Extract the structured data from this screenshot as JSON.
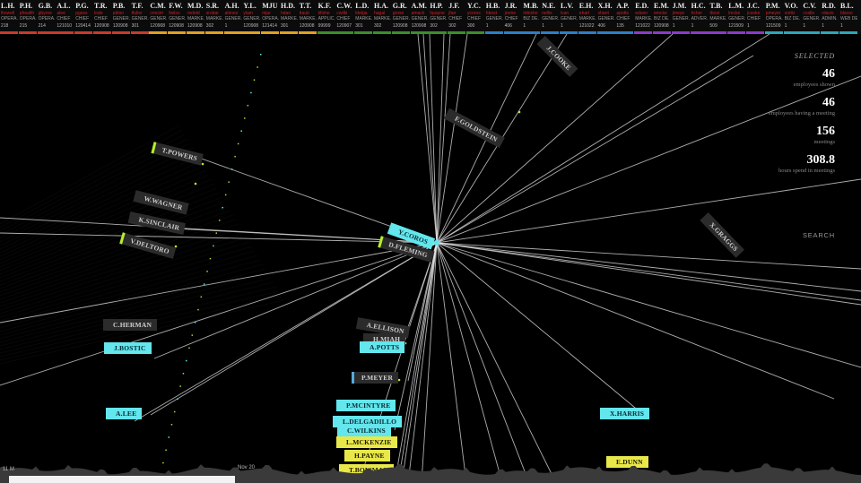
{
  "header": {
    "columns": [
      {
        "name": "L.H.",
        "email": "lhowell",
        "title": "OPERA.",
        "phone": "218",
        "color": "#c83a2a"
      },
      {
        "name": "P.H.",
        "email": "phealth",
        "title": "OPERA.",
        "phone": "215",
        "color": "#c83a2a"
      },
      {
        "name": "G.B.",
        "email": "gbyrne",
        "title": "OPERA.",
        "phone": "214",
        "color": "#c83a2a"
      },
      {
        "name": "A.L.",
        "email": "alee",
        "title": "CHIEF",
        "phone": "121010",
        "color": "#c83a2a"
      },
      {
        "name": "P.G.",
        "email": "pgoss",
        "title": "CHIEF",
        "phone": "120414",
        "color": "#c83a2a"
      },
      {
        "name": "T.R.",
        "email": "trale",
        "title": "CHIEF",
        "phone": "120908",
        "color": "#c83a2a"
      },
      {
        "name": "P.B.",
        "email": "pbloo",
        "title": "GENER.",
        "phone": "120908",
        "color": "#c83a2a"
      },
      {
        "name": "T.F.",
        "email": "tfuller",
        "title": "GENER.",
        "phone": "301",
        "color": "#c83a2a"
      },
      {
        "name": "C.M.",
        "email": "cmcint",
        "title": "GENER.",
        "phone": "120908",
        "color": "#e0a020"
      },
      {
        "name": "F.W.",
        "email": "fwilso",
        "title": "GENER.",
        "phone": "120908",
        "color": "#e0a020"
      },
      {
        "name": "M.D.",
        "email": "mdeld",
        "title": "MARKE.",
        "phone": "120908",
        "color": "#e0a020"
      },
      {
        "name": "S.R.",
        "email": "srobar",
        "title": "MARKE.",
        "phone": "302",
        "color": "#e0a020"
      },
      {
        "name": "A.H.",
        "email": "ahinez",
        "title": "GENER.",
        "phone": "1",
        "color": "#e0a020"
      },
      {
        "name": "Y.L.",
        "email": "ylam",
        "title": "GENER.",
        "phone": "120908",
        "color": "#e0a020"
      },
      {
        "name": "MJU",
        "email": "mjur",
        "title": "OPERA.",
        "phone": "121414",
        "color": "#e0a020"
      },
      {
        "name": "H.D.",
        "email": "hdan",
        "title": "MARKE.",
        "phone": "301",
        "color": "#e0a020"
      },
      {
        "name": "T.T.",
        "email": "ttaub",
        "title": "MARKE.",
        "phone": "120908",
        "color": "#e0a020"
      },
      {
        "name": "K.F.",
        "email": "kfishe",
        "title": "APPLIC.",
        "phone": "99999",
        "color": "#3a8f2a"
      },
      {
        "name": "C.W.",
        "email": "cwilki",
        "title": "CHIEF",
        "phone": "120907",
        "color": "#3a8f2a"
      },
      {
        "name": "L.D.",
        "email": "ldelga",
        "title": "MARKE.",
        "phone": "301",
        "color": "#3a8f2a"
      },
      {
        "name": "H.A.",
        "email": "hagal",
        "title": "MARKE.",
        "phone": "302",
        "color": "#3a8f2a"
      },
      {
        "name": "G.R.",
        "email": "grose",
        "title": "GENER.",
        "phone": "120908",
        "color": "#3a8f2a"
      },
      {
        "name": "A.M.",
        "email": "amack",
        "title": "GENER.",
        "phone": "120908",
        "color": "#3a8f2a"
      },
      {
        "name": "H.P.",
        "email": "hpayne",
        "title": "GENER.",
        "phone": "302",
        "color": "#3a8f2a"
      },
      {
        "name": "J.F.",
        "email": "jfarr",
        "title": "CHIEF",
        "phone": "302",
        "color": "#3a8f2a"
      },
      {
        "name": "Y.C.",
        "email": "ycoros",
        "title": "CHIEF",
        "phone": "300",
        "color": "#3a8f2a"
      },
      {
        "name": "H.B.",
        "email": "hbost",
        "title": "GENER.",
        "phone": "1",
        "color": "#2a7fc8"
      },
      {
        "name": "J.R.",
        "email": "jrome",
        "title": "CHIEF",
        "phone": "406",
        "color": "#2a7fc8"
      },
      {
        "name": "M.B.",
        "email": "mbisho",
        "title": "BIZ DE.",
        "phone": "1",
        "color": "#2a7fc8"
      },
      {
        "name": "N.E.",
        "email": "nellis",
        "title": "GENER.",
        "phone": "1",
        "color": "#2a7fc8"
      },
      {
        "name": "L.V.",
        "email": "lvan",
        "title": "GENER.",
        "phone": "1",
        "color": "#2a7fc8"
      },
      {
        "name": "E.H.",
        "email": "ehart",
        "title": "MARKE.",
        "phone": "121022",
        "color": "#2a7fc8"
      },
      {
        "name": "X.H.",
        "email": "xharri",
        "title": "GENER.",
        "phone": "406",
        "color": "#2a7fc8"
      },
      {
        "name": "A.P.",
        "email": "apotts",
        "title": "CHIEF",
        "phone": "135",
        "color": "#2a7fc8"
      },
      {
        "name": "E.D.",
        "email": "edunn",
        "title": "MARKE.",
        "phone": "121022",
        "color": "#8a3ac8"
      },
      {
        "name": "E.M.",
        "email": "emcke",
        "title": "BIZ DE.",
        "phone": "120908",
        "color": "#8a3ac8"
      },
      {
        "name": "J.M.",
        "email": "jmeye",
        "title": "GENER.",
        "phone": "1",
        "color": "#8a3ac8"
      },
      {
        "name": "H.C.",
        "email": "hcher",
        "title": "ADVER.",
        "phone": "1",
        "color": "#8a3ac8"
      },
      {
        "name": "T.B.",
        "email": "tbost",
        "title": "MARKE.",
        "phone": "509",
        "color": "#8a3ac8"
      },
      {
        "name": "L.M.",
        "email": "lmcke",
        "title": "GENER.",
        "phone": "121509",
        "color": "#8a3ac8"
      },
      {
        "name": "J.C.",
        "email": "jcooke",
        "title": "CHIEF",
        "phone": "1",
        "color": "#8a3ac8"
      },
      {
        "name": "P.M.",
        "email": "pmeyer",
        "title": "OPERA.",
        "phone": "121509",
        "color": "#2aa8b8"
      },
      {
        "name": "V.O.",
        "email": "vortiz",
        "title": "BIZ DE.",
        "phone": "1",
        "color": "#2aa8b8"
      },
      {
        "name": "C.V.",
        "email": "cvalle",
        "title": "GENER.",
        "phone": "1",
        "color": "#2aa8b8"
      },
      {
        "name": "R.D.",
        "email": "rdavis",
        "title": "ADMIN.",
        "phone": "1",
        "color": "#2aa8b8"
      },
      {
        "name": "B.L.",
        "email": "blarso",
        "title": "WEB DE.",
        "phone": "1",
        "color": "#2aa8b8"
      }
    ]
  },
  "stats": {
    "selected_label": "SELECTED",
    "employees_shown": "46",
    "employees_shown_label": "employees shown",
    "employees_meeting": "46",
    "employees_meeting_label": "employees having a meeting",
    "meetings": "156",
    "meetings_label": "meetings",
    "hours": "308.8",
    "hours_label": "hours spend in meetings"
  },
  "search": {
    "label": "SEARCH"
  },
  "timeline": {
    "date_label": "Nov 20",
    "start_label": "11 M"
  },
  "nodes": [
    {
      "label": "J.COOKE",
      "style": "gray",
      "accent": ""
    },
    {
      "label": "F.GOLDSTEIN",
      "style": "gray",
      "accent": ""
    },
    {
      "label": "T.POWERS",
      "style": "gray",
      "accent": "lime"
    },
    {
      "label": "W.WAGNER",
      "style": "gray",
      "accent": ""
    },
    {
      "label": "K.SINCLAIR",
      "style": "gray",
      "accent": ""
    },
    {
      "label": "V.DELTORO",
      "style": "gray",
      "accent": "lime"
    },
    {
      "label": "Y.COROS",
      "style": "cyan",
      "accent": ""
    },
    {
      "label": "D.FLEMING",
      "style": "gray",
      "accent": "lime"
    },
    {
      "label": "X.GRAGGS",
      "style": "gray",
      "accent": ""
    },
    {
      "label": "C.HERMAN",
      "style": "gray",
      "accent": ""
    },
    {
      "label": "J.BOSTIC",
      "style": "cyan",
      "accent": ""
    },
    {
      "label": "A.LEE",
      "style": "cyan",
      "accent": ""
    },
    {
      "label": "A.ELLISON",
      "style": "gray",
      "accent": ""
    },
    {
      "label": "H.MIAH",
      "style": "gray",
      "accent": ""
    },
    {
      "label": "A.POTTS",
      "style": "cyan",
      "accent": ""
    },
    {
      "label": "P.MEYER",
      "style": "gray",
      "accent": "teal"
    },
    {
      "label": "P.MCINTYRE",
      "style": "cyan",
      "accent": ""
    },
    {
      "label": "L.DELGADILLO",
      "style": "cyan",
      "accent": ""
    },
    {
      "label": "C.WILKINS",
      "style": "cyan",
      "accent": ""
    },
    {
      "label": "L.MCKENZIE",
      "style": "yellow",
      "accent": ""
    },
    {
      "label": "H.PAYNE",
      "style": "yellow",
      "accent": ""
    },
    {
      "label": "T.BOWMAN",
      "style": "yellow",
      "accent": ""
    },
    {
      "label": "X.HARRIS",
      "style": "cyan",
      "accent": ""
    },
    {
      "label": "E.DUNN",
      "style": "yellow",
      "accent": ""
    }
  ]
}
